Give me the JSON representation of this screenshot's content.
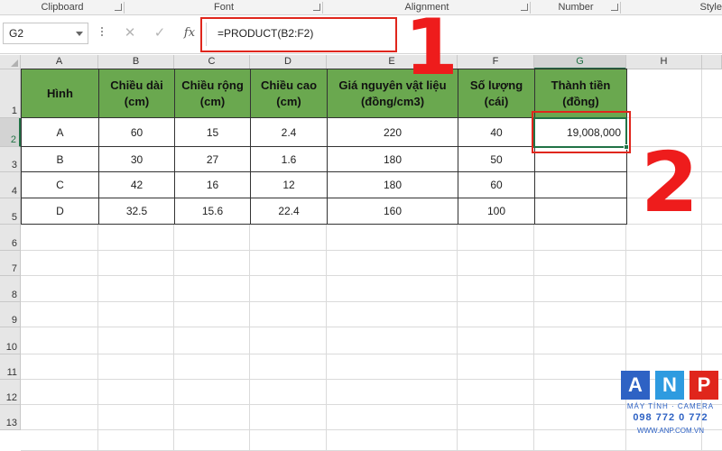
{
  "ribbon": {
    "groups": [
      "Clipboard",
      "Font",
      "Alignment",
      "Number",
      "Style"
    ]
  },
  "formula_bar": {
    "name_box": "G2",
    "cancel_icon": "✕",
    "enter_icon": "✓",
    "fx_label": "fx",
    "formula": "=PRODUCT(B2:F2)"
  },
  "annotations": {
    "step1": "1",
    "step2": "2"
  },
  "columns": [
    "A",
    "B",
    "C",
    "D",
    "E",
    "F",
    "G",
    "H"
  ],
  "rows": [
    "1",
    "2",
    "3",
    "4",
    "5",
    "6",
    "7",
    "8",
    "9",
    "10",
    "11",
    "12",
    "13"
  ],
  "table": {
    "headers": [
      "Hình",
      "Chiều dài (cm)",
      "Chiều rộng (cm)",
      "Chiều cao (cm)",
      "Giá nguyên vật liệu (đồng/cm3)",
      "Số lượng (cái)",
      "Thành tiền (đồng)"
    ],
    "rows": [
      [
        "A",
        "60",
        "15",
        "2.4",
        "220",
        "40",
        "19,008,000"
      ],
      [
        "B",
        "30",
        "27",
        "1.6",
        "180",
        "50",
        ""
      ],
      [
        "C",
        "42",
        "16",
        "12",
        "180",
        "60",
        ""
      ],
      [
        "D",
        "32.5",
        "15.6",
        "22.4",
        "160",
        "100",
        ""
      ]
    ]
  },
  "selected_cell": "G2",
  "header_fill_color": "#6aa84f",
  "watermark": {
    "letters": [
      "A",
      "N",
      "P"
    ],
    "colors": [
      "#2e62c4",
      "#2e9be0",
      "#e0261c"
    ],
    "line1": "MÁY TÍNH · CAMERA",
    "line2": "098 772 0 772",
    "line3": "WWW.ANP.COM.VN"
  }
}
